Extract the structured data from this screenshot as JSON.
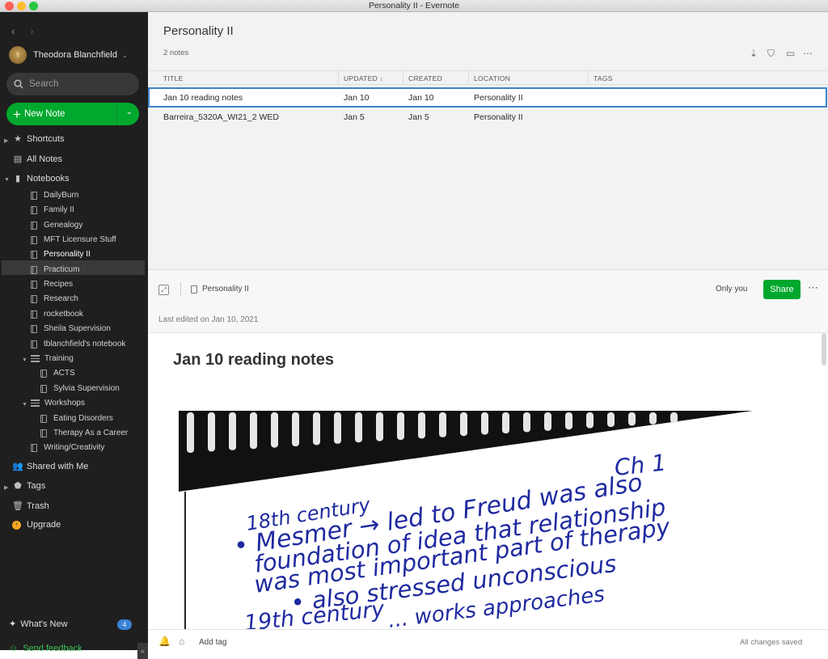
{
  "window": {
    "title": "Personality II - Evernote"
  },
  "sidebar": {
    "account": "Theodora Blanchfield",
    "search_placeholder": "Search",
    "new_note": "New Note",
    "shortcuts": "Shortcuts",
    "all_notes": "All Notes",
    "notebooks": "Notebooks",
    "notebook_items": [
      "DailyBurn",
      "Family II",
      "Genealogy",
      "MFT Licensure Stuff",
      "Personality II",
      "Practicum",
      "Recipes",
      "Research",
      "rocketbook",
      "Sheila Supervision",
      "tblanchfield's notebook"
    ],
    "training": {
      "label": "Training",
      "children": [
        "ACTS",
        "Sylvia Supervision"
      ]
    },
    "workshops": {
      "label": "Workshops",
      "children": [
        "Eating Disorders",
        "Therapy As a Career"
      ]
    },
    "writing": "Writing/Creativity",
    "shared": "Shared with Me",
    "tags": "Tags",
    "trash": "Trash",
    "upgrade": "Upgrade",
    "whats_new": "What's New",
    "whats_new_count": "4",
    "send_feedback": "Send feedback"
  },
  "list": {
    "title": "Personality II",
    "count": "2 notes",
    "columns": {
      "title": "TITLE",
      "updated": "UPDATED ↓",
      "created": "CREATED",
      "location": "LOCATION",
      "tags": "TAGS"
    },
    "rows": [
      {
        "title": "Jan 10 reading notes",
        "updated": "Jan 10",
        "created": "Jan 10",
        "location": "Personality II"
      },
      {
        "title": "Barreira_5320A_WI21_2 WED",
        "updated": "Jan 5",
        "created": "Jan 5",
        "location": "Personality II"
      }
    ]
  },
  "editor": {
    "notebook": "Personality II",
    "only_you": "Only you",
    "share": "Share",
    "last_edited": "Last edited on Jan 10, 2021",
    "note_title": "Jan 10 reading notes",
    "handwriting": [
      "Ch 1",
      "18th century",
      "• Mesmer → led to Freud was also",
      "foundation of idea that relationship",
      "was most important part of therapy",
      "• also stressed unconscious",
      "19th century",
      "... works approaches"
    ],
    "add_tag": "Add tag",
    "status": "All changes saved"
  },
  "colors": {
    "accent": "#00a82d",
    "sidebar": "#1f1f1f",
    "selection": "#3d83c6"
  }
}
